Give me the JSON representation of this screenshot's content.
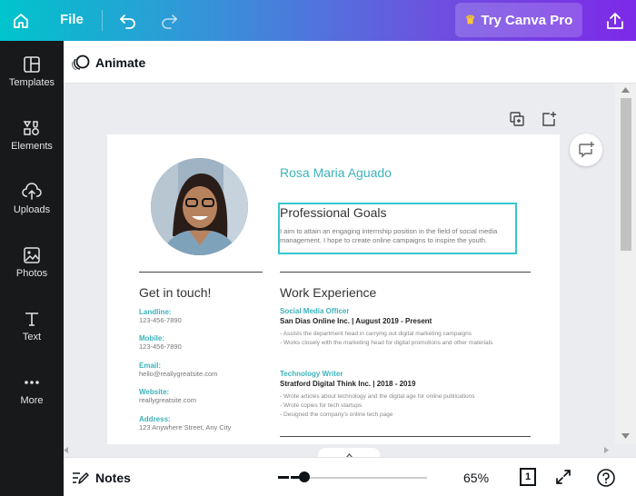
{
  "topbar": {
    "file_label": "File",
    "try_pro_label": "Try Canva Pro"
  },
  "sidebar": {
    "items": [
      {
        "label": "Templates",
        "icon": "templates-icon"
      },
      {
        "label": "Elements",
        "icon": "elements-icon"
      },
      {
        "label": "Uploads",
        "icon": "uploads-icon"
      },
      {
        "label": "Photos",
        "icon": "photos-icon"
      },
      {
        "label": "Text",
        "icon": "text-icon"
      },
      {
        "label": "More",
        "icon": "more-icon"
      }
    ]
  },
  "animate": {
    "label": "Animate"
  },
  "resume": {
    "name": "Rosa Maria Aguado",
    "goals_title": "Professional Goals",
    "goals_text": "I aim to attain an engaging internship position in the field of social media management. I hope to create online campaigns to inspire the youth.",
    "contact_title": "Get in touch!",
    "contacts": [
      {
        "label": "Landline:",
        "value": "123-456-7890"
      },
      {
        "label": "Mobile:",
        "value": "123-456-7890"
      },
      {
        "label": "Email:",
        "value": "hello@reallygreatsite.com"
      },
      {
        "label": "Website:",
        "value": "reallygreatsite.com"
      },
      {
        "label": "Address:",
        "value": "123 Anywhere Street, Any City"
      }
    ],
    "experience_title": "Work Experience",
    "jobs": [
      {
        "title": "Social Media Officer",
        "company": "San Dias Online Inc. | August 2019 - Present",
        "bullets": "- Assists the department head in carrying out digital marketing campaigns\n- Works closely with the marketing head for digital promotions and other materials"
      },
      {
        "title": "Technology Writer",
        "company": "Stratford Digital Think Inc. | 2018 - 2019",
        "bullets": "- Wrote articles about technology and the digital age for online publications\n- Wrote copies for tech startups\n- Designed the company's online tech page"
      }
    ]
  },
  "bottombar": {
    "notes_label": "Notes",
    "zoom_label": "65%",
    "zoom_level": 0.1,
    "page_count": "1"
  },
  "colors": {
    "accent": "#3cb3ba",
    "selection": "#38c6d0",
    "sidebar_bg": "#18191b"
  }
}
